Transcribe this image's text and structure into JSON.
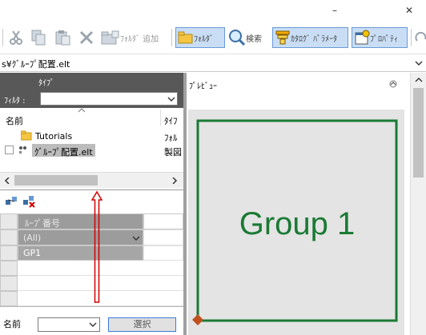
{
  "window": {
    "minimize_glyph": "–",
    "close_glyph": "✕"
  },
  "toolbar": {
    "folder_add_label": "ﾌｫﾙﾀﾞ 追加",
    "folder_label": "ﾌｫﾙﾀﾞ",
    "search_label": "検索",
    "catalog_param_label": "ｶﾀﾛｸﾞ ﾊﾟﾗﾒｰﾀ",
    "properties_label": "ﾌﾟﾛﾊﾟﾃｨ"
  },
  "path": {
    "text": "s¥ｸﾞﾙｰﾌﾟ配置.elt"
  },
  "left_panel": {
    "type_label": "ﾀｲﾌﾟ",
    "filter_label": "ﾌｨﾙﾀ :",
    "filter_value": "",
    "columns": {
      "name": "名前",
      "type": "ﾀｲﾌ"
    },
    "items": [
      {
        "name": "Tutorials",
        "type": "ﾌｫﾙ"
      },
      {
        "name": "ｸﾞﾙｰﾌﾟ配置.elt",
        "type": "製図"
      }
    ]
  },
  "grid": {
    "header": "ﾙｰﾌﾟ番号",
    "filter_value": "(All)",
    "rows": [
      "GP1",
      "",
      "",
      "",
      ""
    ]
  },
  "bottom": {
    "label": "名前",
    "combo_value": "",
    "select_button": "選択"
  },
  "preview": {
    "title": "ﾌﾟﾚﾋﾞｭｰ",
    "drawing_text": "Group 1",
    "colors": {
      "frame": "#1a7a34",
      "text": "#1a7a34",
      "origin": "#c0501f"
    }
  },
  "colors": {
    "annotation_arrow": "#d00000",
    "active_toolbar": "#c9def5"
  }
}
